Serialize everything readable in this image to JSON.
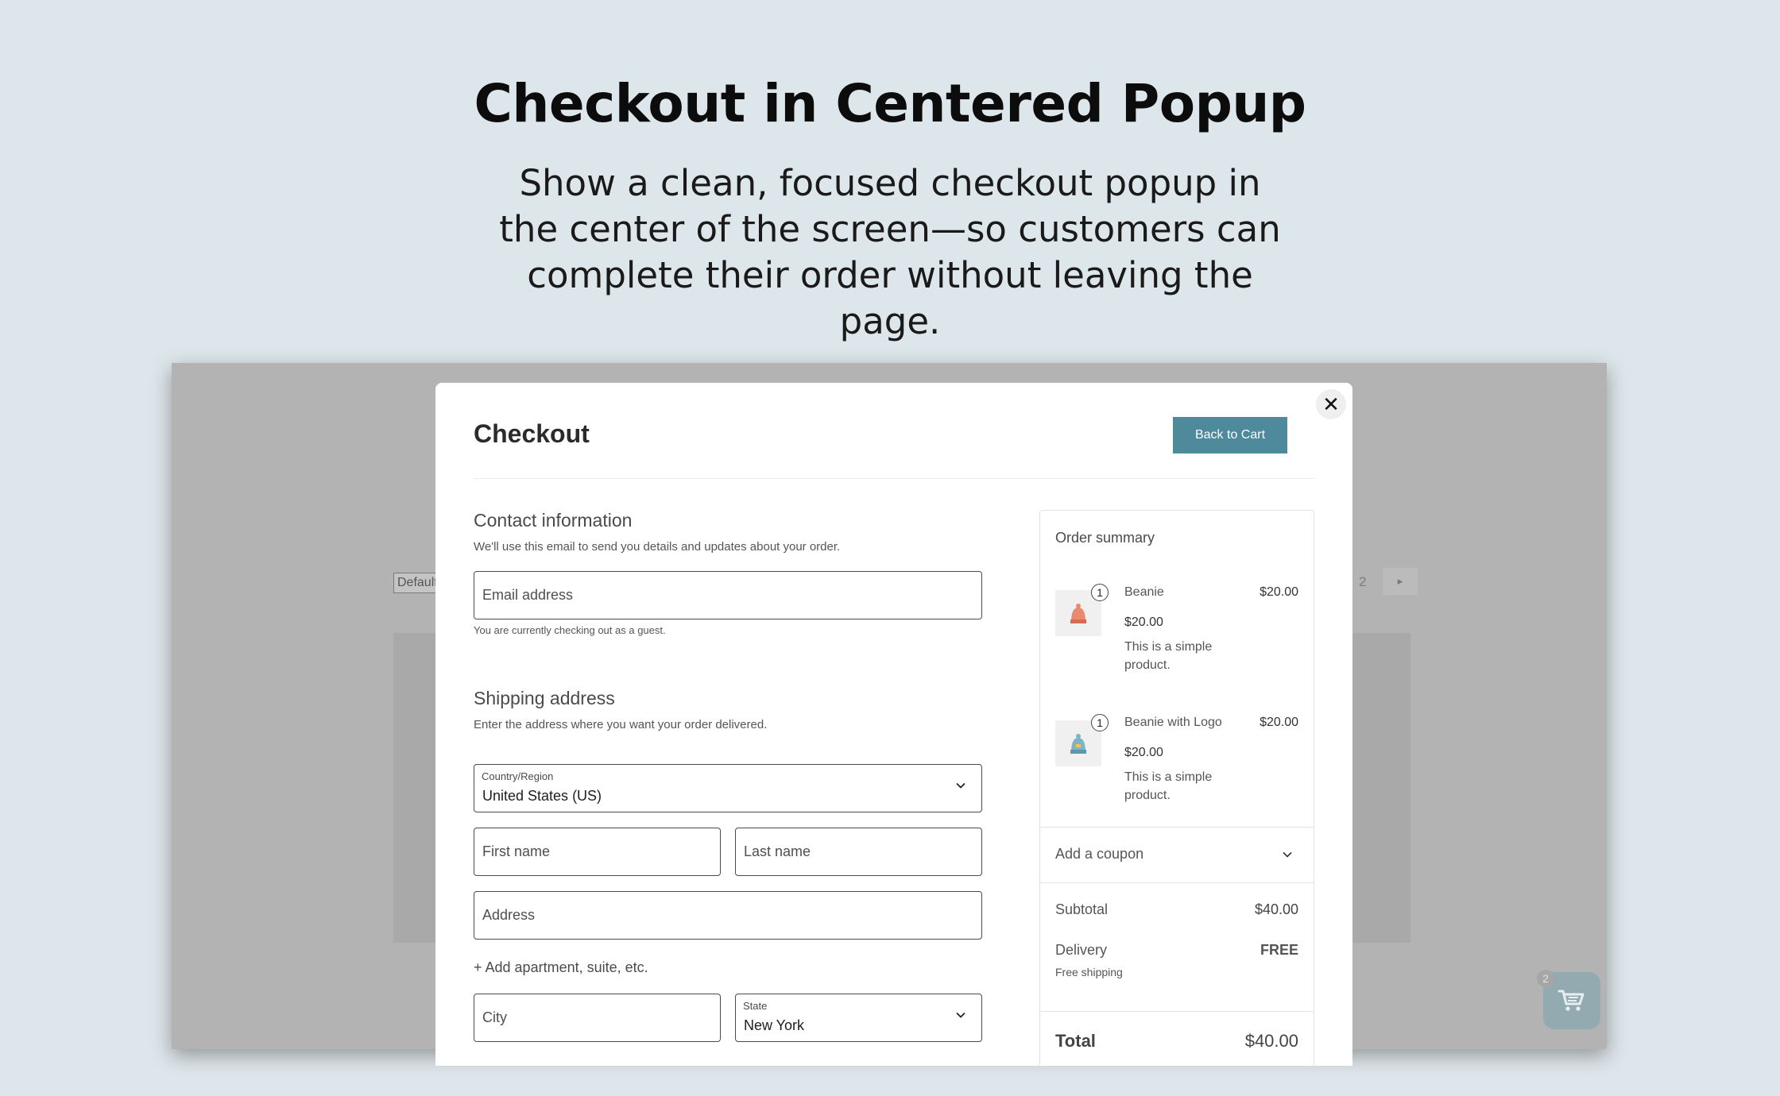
{
  "hero": {
    "title": "Checkout in Centered Popup",
    "subtitle": "Show a clean, focused checkout popup in the center of the screen—so customers can complete their order without leaving the page."
  },
  "background_page": {
    "sort_select": "Default",
    "page_number": "2",
    "cart_count": "2"
  },
  "modal": {
    "title": "Checkout",
    "back_button": "Back to Cart",
    "close": "✕"
  },
  "contact": {
    "title": "Contact information",
    "description": "We'll use this email to send you details and updates about your order.",
    "email_placeholder": "Email address",
    "guest_note": "You are currently checking out as a guest."
  },
  "shipping": {
    "title": "Shipping address",
    "description": "Enter the address where you want your order delivered.",
    "country_label": "Country/Region",
    "country_value": "United States (US)",
    "first_name_placeholder": "First name",
    "last_name_placeholder": "Last name",
    "address_placeholder": "Address",
    "add_apartment": "+ Add apartment, suite, etc.",
    "city_placeholder": "City",
    "state_label": "State",
    "state_value": "New York"
  },
  "summary": {
    "title": "Order summary",
    "items": [
      {
        "name": "Beanie",
        "qty": "1",
        "price": "$20.00",
        "unit_price": "$20.00",
        "description": "This is a simple product.",
        "thumb_color": "#e98a6e"
      },
      {
        "name": "Beanie with Logo",
        "qty": "1",
        "price": "$20.00",
        "unit_price": "$20.00",
        "description": "This is a simple product.",
        "thumb_color": "#7fb3c6"
      }
    ],
    "coupon": "Add a coupon",
    "subtotal_label": "Subtotal",
    "subtotal_value": "$40.00",
    "delivery_label": "Delivery",
    "delivery_value": "FREE",
    "shipping_note": "Free shipping",
    "total_label": "Total",
    "total_value": "$40.00"
  },
  "colors": {
    "page_background": "#dde6ea",
    "accent_button": "#4e8a9b",
    "overlay": "#b3b3b3"
  }
}
